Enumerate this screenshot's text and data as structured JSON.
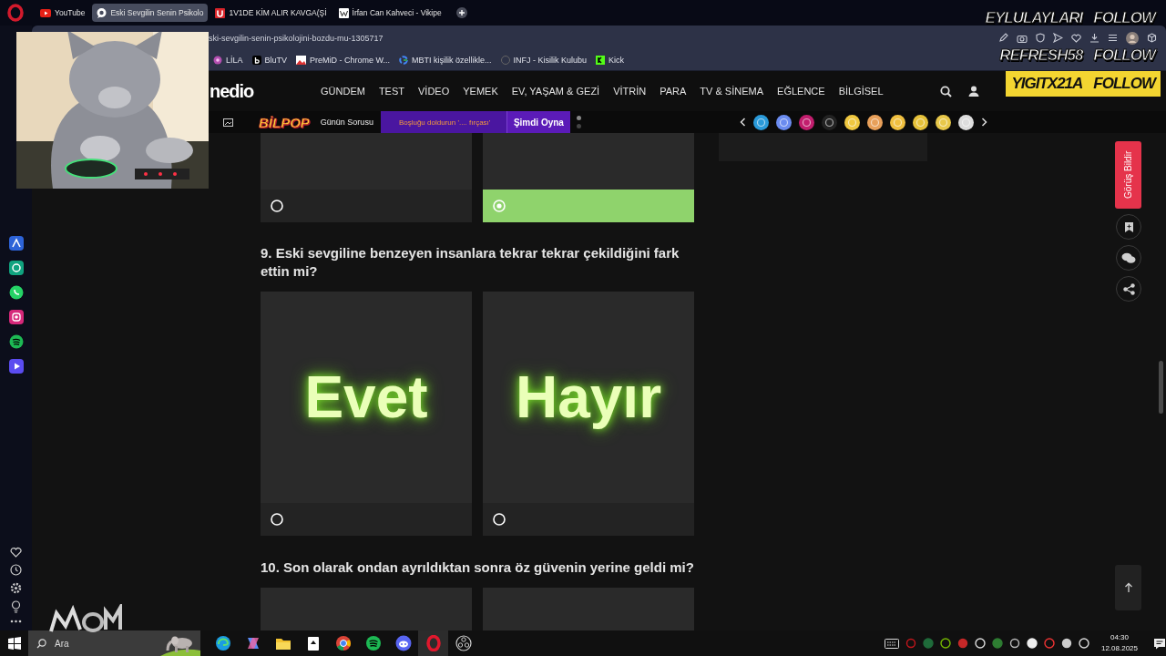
{
  "browser": {
    "tabs": [
      {
        "title": "YouTube",
        "selected": false
      },
      {
        "title": "Eski Sevgilin Senin Psikolo",
        "selected": true
      },
      {
        "title": "1V1DE KİM ALIR KAVGA(Şİ",
        "selected": false
      },
      {
        "title": "İrfan Can Kahveci - Vikipe",
        "selected": false
      }
    ],
    "address": "ski-sevgilin-senin-psikolojini-bozdu-mu-1305717",
    "bookmarks": [
      "LİLA",
      "BluTV",
      "PreMiD - Chrome W...",
      "MBTI kişilik özellikle...",
      "INFJ - Kisilik Kulubu",
      "Kick"
    ]
  },
  "site": {
    "logo": "nedio",
    "nav": [
      "GÜNDEM",
      "TEST",
      "VİDEO",
      "YEMEK",
      "EV, YAŞAM & GEZİ",
      "VİTRİN",
      "PARA",
      "TV & SİNEMA",
      "EĞLENCE",
      "BİLGİSEL"
    ],
    "bilpop": {
      "logo": "BİLPOP",
      "label": "Günün Sorusu",
      "prompt": "Boşluğu doldurun '.... fırçası'",
      "play": "Şimdi Oyna"
    }
  },
  "quiz": {
    "previous_options": [
      {
        "kind": "plain",
        "selected": false
      },
      {
        "kind": "plain",
        "selected": true
      }
    ],
    "questions": [
      {
        "text": "9. Eski sevgiline benzeyen insanlara tekrar tekrar çekildiğini fark ettin mi?",
        "options": [
          {
            "kind": "labeled",
            "label": "Evet",
            "selected": false
          },
          {
            "kind": "labeled",
            "label": "Hayır",
            "selected": false
          }
        ]
      },
      {
        "text": "10. Son olarak ondan ayrıldıktan sonra öz güvenin yerine geldi mi?",
        "options": [
          {
            "kind": "plain"
          },
          {
            "kind": "plain"
          }
        ]
      }
    ]
  },
  "feedback_button": "Görüş Bildir",
  "overlay": {
    "follows": [
      {
        "name": "EYLULAYLARI",
        "action": "FOLLOW",
        "highlighted": false
      },
      {
        "name": "REFRESH58",
        "action": "FOLLOW",
        "highlighted": false
      },
      {
        "name": "YIGITX21A",
        "action": "FOLLOW",
        "highlighted": true
      }
    ]
  },
  "taskbar": {
    "search_placeholder": "Ara",
    "time": "04:30",
    "date": "12.08.2025"
  }
}
